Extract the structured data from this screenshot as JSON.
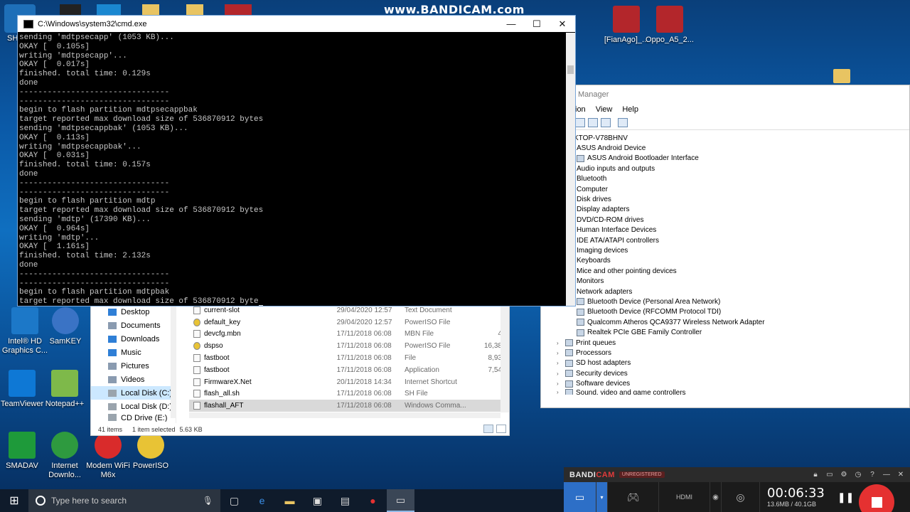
{
  "watermark": "www.BANDICAM.com",
  "desktop_icons_left": [
    {
      "label": "Intel® HD Graphics C...",
      "color": "#1c78c8"
    },
    {
      "label": "SamKEY",
      "color": "#3a73c5"
    },
    {
      "label": "TeamViewer",
      "color": "#0e78d5"
    },
    {
      "label": "Notepad++",
      "color": "#7eb94a"
    },
    {
      "label": "SMADAV",
      "color": "#1e9a3a"
    },
    {
      "label": "Internet Downlo...",
      "color": "#2e9a3f"
    },
    {
      "label": "Modem WiFi M6x",
      "color": "#d92b2b"
    },
    {
      "label": "PowerISO",
      "color": "#e8c335"
    }
  ],
  "desktop_icons_right": [
    {
      "label": "[FianAgo]_...",
      "color": "#b3262b"
    },
    {
      "label": "Oppo_A5_2...",
      "color": "#b3262b"
    }
  ],
  "cmd": {
    "title": "C:\\Windows\\system32\\cmd.exe",
    "minimize": "—",
    "maximize": "☐",
    "close": "✕",
    "lines": [
      "sending 'mdtpsecapp' (1053 KB)...",
      "OKAY [  0.105s]",
      "writing 'mdtpsecapp'...",
      "OKAY [  0.017s]",
      "finished. total time: 0.129s",
      "done",
      "--------------------------------",
      "--------------------------------",
      "begin to flash partition mdtpsecappbak",
      "target reported max download size of 536870912 bytes",
      "sending 'mdtpsecappbak' (1053 KB)...",
      "OKAY [  0.113s]",
      "writing 'mdtpsecappbak'...",
      "OKAY [  0.031s]",
      "finished. total time: 0.157s",
      "done",
      "--------------------------------",
      "--------------------------------",
      "begin to flash partition mdtp",
      "target reported max download size of 536870912 bytes",
      "sending 'mdtp' (17390 KB)...",
      "OKAY [  0.964s]",
      "writing 'mdtp'...",
      "OKAY [  1.161s]",
      "finished. total time: 2.132s",
      "done",
      "--------------------------------",
      "--------------------------------",
      "begin to flash partition mdtpbak",
      "target reported max download size of 536870912 byte"
    ]
  },
  "explorer": {
    "nav": [
      {
        "label": "Desktop",
        "color": "#2f7fd6"
      },
      {
        "label": "Documents",
        "color": "#8a9bb0"
      },
      {
        "label": "Downloads",
        "color": "#2f7fd6"
      },
      {
        "label": "Music",
        "color": "#2f7fd6"
      },
      {
        "label": "Pictures",
        "color": "#8a9bb0"
      },
      {
        "label": "Videos",
        "color": "#8a9bb0"
      },
      {
        "label": "Local Disk (C:)",
        "color": "#9aa4ad"
      },
      {
        "label": "Local Disk (D:)",
        "color": "#9aa4ad"
      },
      {
        "label": "CD Drive (E:)",
        "color": "#9aa4ad"
      }
    ],
    "files": [
      {
        "name": "current-slot",
        "date": "29/04/2020 12:57",
        "type": "Text Document",
        "size": ""
      },
      {
        "name": "default_key",
        "date": "29/04/2020 12:57",
        "type": "PowerISO File",
        "size": ""
      },
      {
        "name": "devcfg.mbn",
        "date": "17/11/2018 06:08",
        "type": "MBN File",
        "size": "4"
      },
      {
        "name": "dspso",
        "date": "17/11/2018 06:08",
        "type": "PowerISO File",
        "size": "16,38"
      },
      {
        "name": "fastboot",
        "date": "17/11/2018 06:08",
        "type": "File",
        "size": "8,93"
      },
      {
        "name": "fastboot",
        "date": "17/11/2018 06:08",
        "type": "Application",
        "size": "7,54"
      },
      {
        "name": "FirmwareX.Net",
        "date": "20/11/2018 14:34",
        "type": "Internet Shortcut",
        "size": ""
      },
      {
        "name": "flash_all.sh",
        "date": "17/11/2018 06:08",
        "type": "SH File",
        "size": ""
      },
      {
        "name": "flashall_AFT",
        "date": "17/11/2018 06:08",
        "type": "Windows Comma...",
        "size": ""
      }
    ],
    "status_count": "41 items",
    "status_selected": "1 item selected",
    "status_size": "5.63 KB"
  },
  "devmgr": {
    "title": "Manager",
    "menu": [
      "ion",
      "View",
      "Help"
    ],
    "tree": [
      {
        "label": "KTOP-V78BHNV",
        "level": 0,
        "exp": ""
      },
      {
        "label": "ASUS Android Device",
        "level": 1,
        "exp": ""
      },
      {
        "label": "ASUS Android Bootloader Interface",
        "level": 2,
        "exp": ""
      },
      {
        "label": "Audio inputs and outputs",
        "level": 1,
        "exp": ""
      },
      {
        "label": "Bluetooth",
        "level": 1,
        "exp": ""
      },
      {
        "label": "Computer",
        "level": 1,
        "exp": ""
      },
      {
        "label": "Disk drives",
        "level": 1,
        "exp": ""
      },
      {
        "label": "Display adapters",
        "level": 1,
        "exp": ""
      },
      {
        "label": "DVD/CD-ROM drives",
        "level": 1,
        "exp": ""
      },
      {
        "label": "Human Interface Devices",
        "level": 1,
        "exp": ""
      },
      {
        "label": "IDE ATA/ATAPI controllers",
        "level": 1,
        "exp": ""
      },
      {
        "label": "Imaging devices",
        "level": 1,
        "exp": ""
      },
      {
        "label": "Keyboards",
        "level": 1,
        "exp": ""
      },
      {
        "label": "Mice and other pointing devices",
        "level": 1,
        "exp": ""
      },
      {
        "label": "Monitors",
        "level": 1,
        "exp": ""
      },
      {
        "label": "Network adapters",
        "level": 1,
        "exp": ""
      },
      {
        "label": "Bluetooth Device (Personal Area Network)",
        "level": 2,
        "exp": ""
      },
      {
        "label": "Bluetooth Device (RFCOMM Protocol TDI)",
        "level": 2,
        "exp": ""
      },
      {
        "label": "Qualcomm Atheros QCA9377 Wireless Network Adapter",
        "level": 2,
        "exp": ""
      },
      {
        "label": "Realtek PCIe GBE Family Controller",
        "level": 2,
        "exp": ""
      },
      {
        "label": "Print queues",
        "level": 3,
        "exp": "›"
      },
      {
        "label": "Processors",
        "level": 3,
        "exp": "›"
      },
      {
        "label": "SD host adapters",
        "level": 3,
        "exp": "›"
      },
      {
        "label": "Security devices",
        "level": 3,
        "exp": "›"
      },
      {
        "label": "Software devices",
        "level": 3,
        "exp": "›"
      },
      {
        "label": "Sound, video and game controllers",
        "level": 3,
        "exp": "›"
      }
    ]
  },
  "bandicam": {
    "brand_a": "BANDI",
    "brand_b": "CAM",
    "unregistered": "UNREGISTERED",
    "time": "00:06:33",
    "size": "13.6MB / 40.1GB",
    "pause": "❚❚"
  },
  "taskbar": {
    "search_placeholder": "Type here to search"
  }
}
